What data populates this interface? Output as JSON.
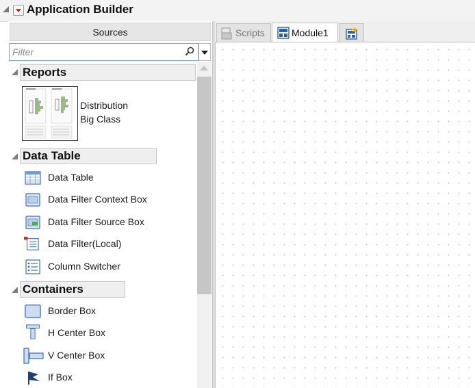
{
  "title": "Application Builder",
  "sources_panel": {
    "header": "Sources",
    "filter_placeholder": "Filter",
    "sections": [
      {
        "label": "Reports",
        "items": [
          {
            "label_line1": "Distribution",
            "label_line2": "Big Class"
          }
        ]
      },
      {
        "label": "Data Table",
        "items": [
          {
            "label": "Data Table",
            "icon": "data-table-icon"
          },
          {
            "label": "Data Filter Context Box",
            "icon": "data-filter-context-box-icon"
          },
          {
            "label": "Data Filter Source Box",
            "icon": "data-filter-source-box-icon"
          },
          {
            "label": "Data Filter(Local)",
            "icon": "data-filter-local-icon"
          },
          {
            "label": "Column Switcher",
            "icon": "column-switcher-icon"
          }
        ]
      },
      {
        "label": "Containers",
        "items": [
          {
            "label": "Border Box",
            "icon": "border-box-icon"
          },
          {
            "label": "H Center Box",
            "icon": "h-center-box-icon"
          },
          {
            "label": "V Center Box",
            "icon": "v-center-box-icon"
          },
          {
            "label": "If Box",
            "icon": "flag-icon"
          }
        ]
      }
    ]
  },
  "tabs": [
    {
      "label": "Scripts",
      "active": false
    },
    {
      "label": "Module1",
      "active": true
    }
  ],
  "colors": {
    "accent_blue": "#2b5fa8",
    "red_arrow": "#d41f1f"
  }
}
